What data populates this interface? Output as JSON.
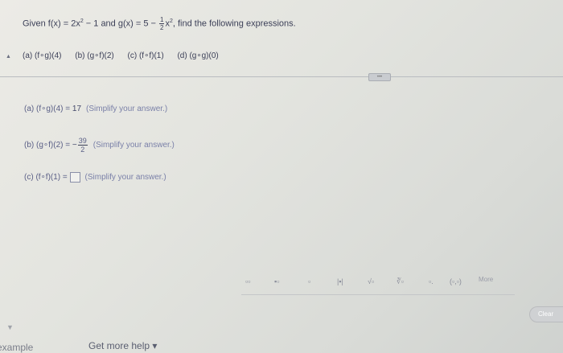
{
  "problem": {
    "prefix": "Given f(x) = 2x",
    "exp1": "2",
    "mid": " − 1 and g(x) = 5 − ",
    "frac_num": "1",
    "frac_den": "2",
    "x": "x",
    "exp2": "2",
    "suffix": ", find the following expressions."
  },
  "parts": [
    "(a) (f∘g)(4)",
    "(b) (g∘f)(2)",
    "(c) (f∘f)(1)",
    "(d) (g∘g)(0)"
  ],
  "answers": {
    "a": {
      "label": "(a) (f∘g)(4) = ",
      "value": "17",
      "hint": "(Simplify your answer.)"
    },
    "b": {
      "label": "(b) (g∘f)(2) = ",
      "sign": "−",
      "frac_num": "39",
      "frac_den": "2",
      "hint": "(Simplify your answer.)"
    },
    "c": {
      "label": "(c) (f∘f)(1) = ",
      "hint": "(Simplify your answer.)"
    }
  },
  "toolbar": {
    "items": [
      "▫▫",
      "▪▫",
      "▫",
      "|▪|",
      "√▫",
      "∛▫",
      "▫.",
      "(▫,▫)"
    ],
    "more": "More",
    "clear": "Clear"
  },
  "footer": {
    "left": "example",
    "help": "Get more help ▾"
  },
  "icons": {
    "collapse": "left-arrow-icon",
    "scroll": "down-arrow-icon"
  },
  "colors": {
    "background": "#e3e4df",
    "text": "#3b3f57",
    "answer_hint": "#7a80a8"
  }
}
